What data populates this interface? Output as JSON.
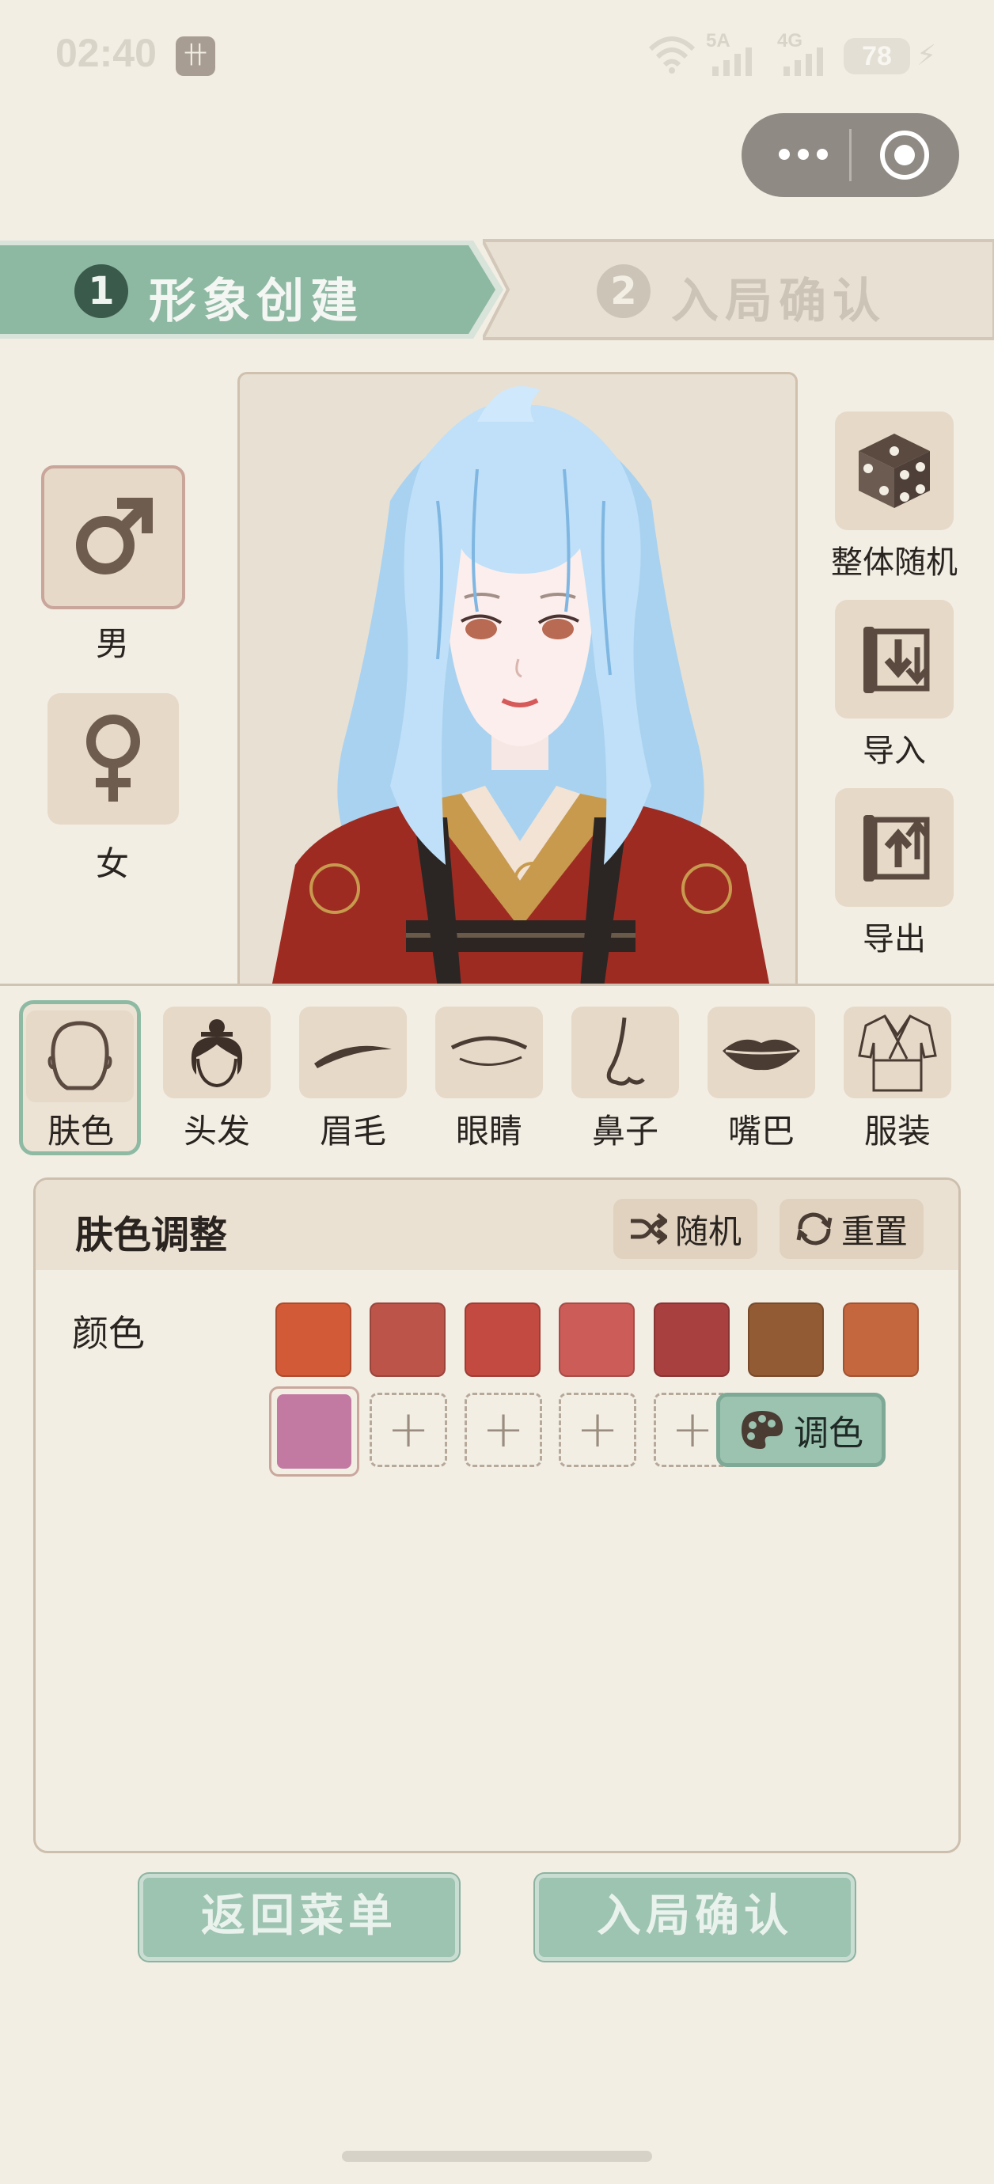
{
  "status_bar": {
    "time": "02:40",
    "network1": "5A",
    "network2": "4G",
    "battery": "78"
  },
  "steps": [
    {
      "num": "1",
      "label": "形象创建",
      "active": true
    },
    {
      "num": "2",
      "label": "入局确认",
      "active": false
    }
  ],
  "gender": {
    "male_label": "男",
    "female_label": "女",
    "selected": "male"
  },
  "tools": {
    "random_all": "整体随机",
    "import": "导入",
    "export": "导出"
  },
  "tabs": [
    {
      "label": "肤色",
      "icon": "face-icon",
      "selected": true
    },
    {
      "label": "头发",
      "icon": "hair-icon"
    },
    {
      "label": "眉毛",
      "icon": "eyebrow-icon"
    },
    {
      "label": "眼睛",
      "icon": "eye-icon"
    },
    {
      "label": "鼻子",
      "icon": "nose-icon"
    },
    {
      "label": "嘴巴",
      "icon": "lips-icon"
    },
    {
      "label": "服装",
      "icon": "robe-icon"
    }
  ],
  "panel": {
    "title": "肤色调整",
    "random_label": "随机",
    "reset_label": "重置",
    "color_label": "颜色",
    "mix_label": "调色",
    "swatches_row1": [
      "#d35a36",
      "#bc544a",
      "#c24a40",
      "#cc5c57",
      "#a8403f",
      "#935b34",
      "#c5673e"
    ],
    "selected_swatch": "#c27aa2",
    "empty_slots": 4
  },
  "bottom": {
    "back_label": "返回菜单",
    "confirm_label": "入局确认"
  }
}
